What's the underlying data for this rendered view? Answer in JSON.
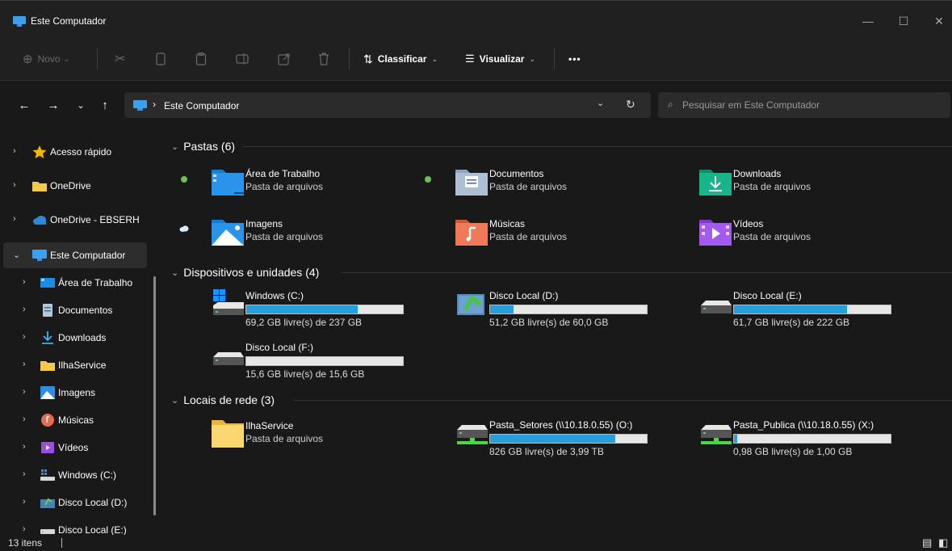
{
  "window": {
    "title": "Este Computador"
  },
  "toolbar": {
    "new_label": "Novo",
    "sort_label": "Classificar",
    "view_label": "Visualizar",
    "more_label": "•••"
  },
  "address": {
    "breadcrumb": "Este Computador",
    "search_placeholder": "Pesquisar em Este Computador"
  },
  "sidebar": {
    "items": [
      {
        "label": "Acesso rápido",
        "icon": "star-icon"
      },
      {
        "label": "OneDrive",
        "icon": "folder-icon"
      },
      {
        "label": "OneDrive - EBSERH",
        "icon": "cloud-icon"
      },
      {
        "label": "Este Computador",
        "icon": "computer-icon"
      },
      {
        "label": "Área de Trabalho",
        "icon": "desktop-icon"
      },
      {
        "label": "Documentos",
        "icon": "documents-icon"
      },
      {
        "label": "Downloads",
        "icon": "download-icon"
      },
      {
        "label": "IlhaService",
        "icon": "folder-icon"
      },
      {
        "label": "Imagens",
        "icon": "pictures-icon"
      },
      {
        "label": "Músicas",
        "icon": "music-icon"
      },
      {
        "label": "Vídeos",
        "icon": "videos-icon"
      },
      {
        "label": "Windows (C:)",
        "icon": "windows-drive-icon"
      },
      {
        "label": "Disco Local (D:)",
        "icon": "drive-icon"
      },
      {
        "label": "Disco Local (E:)",
        "icon": "drive-icon"
      }
    ]
  },
  "groups": {
    "folders": "Pastas (6)",
    "devices": "Dispositivos e unidades (4)",
    "network": "Locais de rede (3)"
  },
  "folders": [
    {
      "name": "Área de Trabalho",
      "sub": "Pasta de arquivos",
      "status": "synced"
    },
    {
      "name": "Documentos",
      "sub": "Pasta de arquivos",
      "status": "synced"
    },
    {
      "name": "Downloads",
      "sub": "Pasta de arquivos",
      "status": ""
    },
    {
      "name": "Imagens",
      "sub": "Pasta de arquivos",
      "status": "cloud"
    },
    {
      "name": "Músicas",
      "sub": "Pasta de arquivos",
      "status": ""
    },
    {
      "name": "Vídeos",
      "sub": "Pasta de arquivos",
      "status": ""
    }
  ],
  "drives": [
    {
      "name": "Windows (C:)",
      "free": "69,2 GB livre(s) de 237 GB",
      "used_fraction": 0.71
    },
    {
      "name": "Disco Local (D:)",
      "free": "51,2 GB livre(s) de 60,0 GB",
      "used_fraction": 0.15
    },
    {
      "name": "Disco Local (E:)",
      "free": "61,7 GB livre(s) de 222 GB",
      "used_fraction": 0.72
    },
    {
      "name": "Disco Local (F:)",
      "free": "15,6 GB livre(s) de 15,6 GB",
      "used_fraction": 0.0
    }
  ],
  "network": [
    {
      "name": "IlhaService",
      "sub": "Pasta de arquivos"
    },
    {
      "name": "Pasta_Setores (\\\\10.18.0.55) (O:)",
      "free": "826 GB livre(s) de 3,99 TB",
      "used_fraction": 0.8
    },
    {
      "name": "Pasta_Publica (\\\\10.18.0.55) (X:)",
      "free": "0,98 GB livre(s) de 1,00 GB",
      "used_fraction": 0.02
    }
  ],
  "status": {
    "count": "13 itens"
  },
  "colors": {
    "accent": "#26a0da",
    "background": "#191919",
    "chrome": "#202020"
  }
}
